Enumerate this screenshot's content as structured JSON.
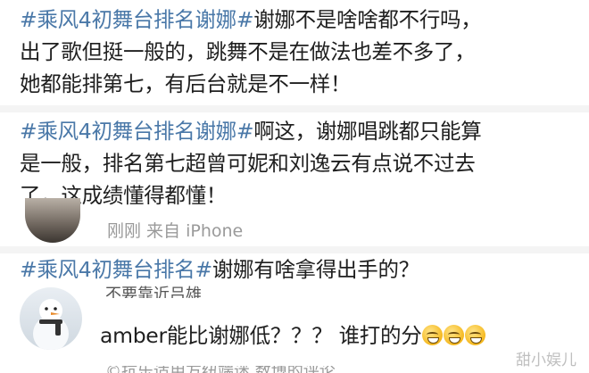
{
  "posts": [
    {
      "tag": "#乘风4初舞台排名谢娜#",
      "text_line1": "谢娜不是啥啥都不行吗，",
      "line2": "出了歌但挺一般的，跳舞不是在做法也差不多了，",
      "line3": "她都能排第七，有后台就是不一样！"
    },
    {
      "tag": "#乘风4初舞台排名谢娜#",
      "text_line1": "啊这，谢娜唱跳都只能算",
      "line2": "是一般，排名第七超曾可妮和刘逸云有点说不过去",
      "line3": "了，这成绩懂得都懂！"
    },
    {
      "tag": "#乘风4初舞台排名#",
      "text_line1": "谢娜有啥拿得出手的？"
    }
  ],
  "comment1": {
    "meta": "刚刚  来自 iPhone"
  },
  "comment2": {
    "username": "不要靠近吕雄",
    "text": "amber能比谢娜低？？？ 谁打的分",
    "emoji_icon": "grin-sweat-emoji"
  },
  "bottom_partial": "©抗乐适用方纽端迷  数博的评论",
  "watermark": "甜小娱儿"
}
